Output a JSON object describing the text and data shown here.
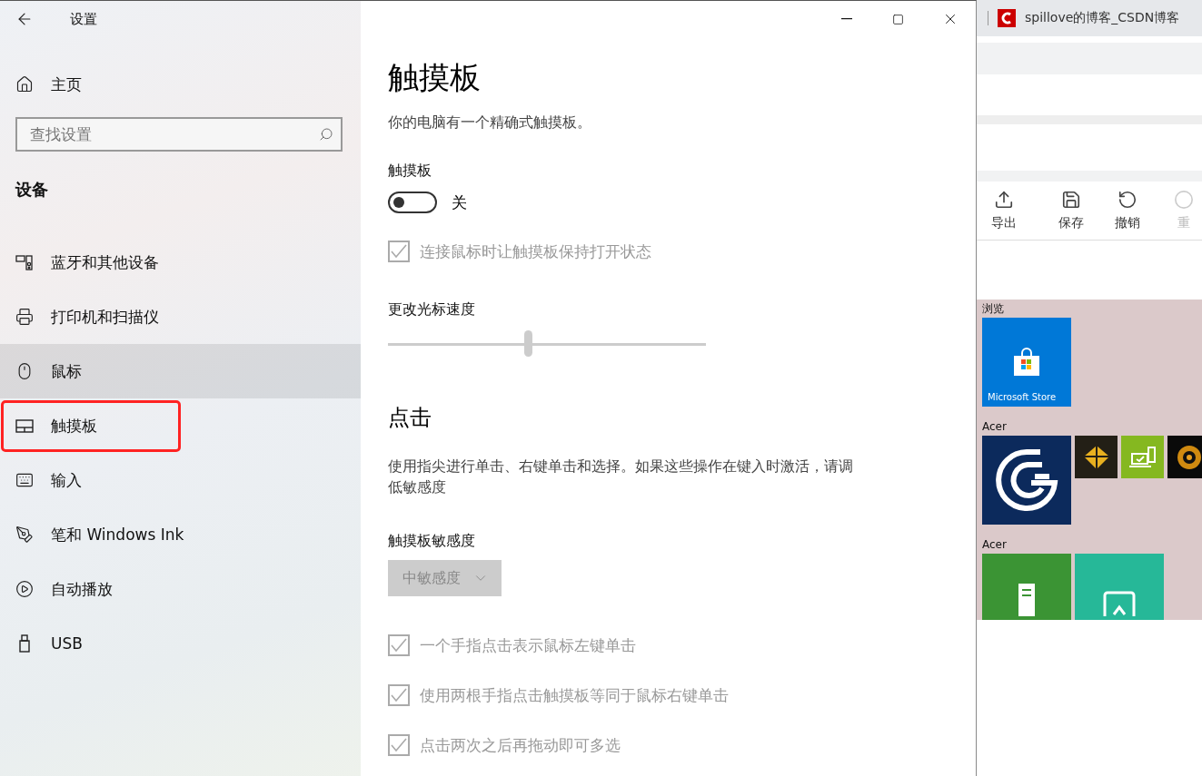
{
  "window": {
    "title": "设置"
  },
  "sidebar": {
    "home": "主页",
    "search": {
      "placeholder": "查找设置"
    },
    "section": "设备",
    "items": [
      {
        "label": "蓝牙和其他设备",
        "kind": "bluetooth",
        "selected": false,
        "highlighted": false
      },
      {
        "label": "打印机和扫描仪",
        "kind": "printer",
        "selected": false,
        "highlighted": false
      },
      {
        "label": "鼠标",
        "kind": "mouse",
        "selected": true,
        "highlighted": false
      },
      {
        "label": "触摸板",
        "kind": "touchpad",
        "selected": false,
        "highlighted": true
      },
      {
        "label": "输入",
        "kind": "keyboard",
        "selected": false,
        "highlighted": false
      },
      {
        "label": "笔和 Windows Ink",
        "kind": "pen",
        "selected": false,
        "highlighted": false
      },
      {
        "label": "自动播放",
        "kind": "autoplay",
        "selected": false,
        "highlighted": false
      },
      {
        "label": "USB",
        "kind": "usb",
        "selected": false,
        "highlighted": false
      }
    ]
  },
  "page": {
    "title": "触摸板",
    "description": "你的电脑有一个精确式触摸板。",
    "toggle": {
      "label": "触摸板",
      "on": false,
      "state_text": "关"
    },
    "keep_on": {
      "label": "连接鼠标时让触摸板保持打开状态",
      "checked": true,
      "disabled": true
    },
    "speed": {
      "label": "更改光标速度",
      "level": 0.44
    },
    "tap": {
      "heading": "点击",
      "description": "使用指尖进行单击、右键单击和选择。如果这些操作在键入时激活，请调低敏感度",
      "sensitivity": {
        "label": "触摸板敏感度",
        "value": "中敏感度",
        "disabled": true
      },
      "options": [
        {
          "label": "一个手指点击表示鼠标左键单击",
          "checked": true,
          "disabled": true
        },
        {
          "label": "使用两根手指点击触摸板等同于鼠标右键单击",
          "checked": true,
          "disabled": true
        },
        {
          "label": "点击两次之后再拖动即可多选",
          "checked": true,
          "disabled": true
        }
      ]
    }
  },
  "background": {
    "browser_tab": {
      "title": "spillove的博客_CSDN博客"
    },
    "toolbar": [
      {
        "label": "导出",
        "kind": "export",
        "disabled": false
      },
      {
        "label": "保存",
        "kind": "save",
        "disabled": false
      },
      {
        "label": "撤销",
        "kind": "undo",
        "disabled": false
      },
      {
        "label": "重",
        "kind": "redo",
        "disabled": true
      }
    ],
    "start_menu": [
      {
        "title": "浏览",
        "tiles": [
          {
            "kind": "store",
            "label": "Microsoft Store",
            "color": "#0078d7"
          }
        ]
      },
      {
        "title": "Acer",
        "tiles": [
          {
            "kind": "acer-g",
            "color": "#0c2a5c"
          },
          {
            "kind": "diamond",
            "color": "#231f16"
          },
          {
            "kind": "laptop",
            "color": "#85b820"
          },
          {
            "kind": "lens",
            "color": "#0a0a0a"
          }
        ]
      },
      {
        "title": "Acer",
        "tiles": [
          {
            "kind": "document",
            "color": "#3b9434"
          },
          {
            "kind": "photo",
            "color": "#26b898"
          }
        ]
      }
    ]
  }
}
